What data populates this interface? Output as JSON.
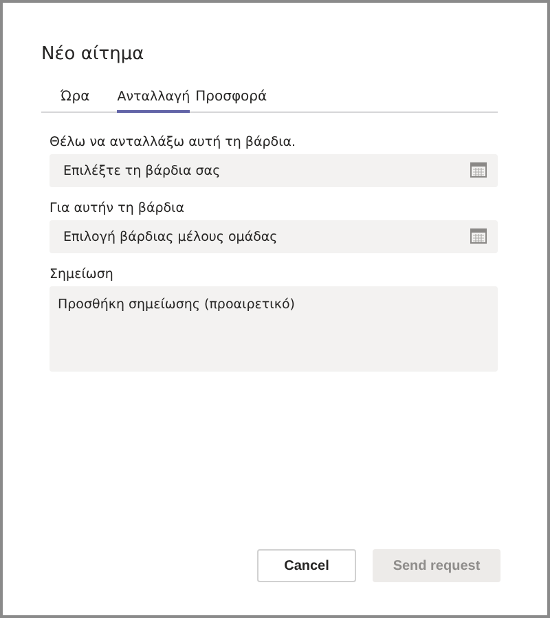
{
  "dialog": {
    "title": "Νέο αίτημα"
  },
  "tabs": [
    {
      "label": "Ώρα",
      "selected": false
    },
    {
      "label": "Ανταλλαγή",
      "selected": true
    },
    {
      "label": "Προσφορά",
      "selected": false
    }
  ],
  "fields": [
    {
      "kind": "date",
      "label": "Θέλω να ανταλλάξω αυτή τη βάρδια.",
      "placeholder": "Επιλέξτε τη βάρδια σας"
    },
    {
      "kind": "date",
      "label": "Για αυτήν τη βάρδια",
      "placeholder": "Επιλογή βάρδιας μέλους ομάδας"
    },
    {
      "kind": "note",
      "label": "Σημείωση",
      "placeholder": "Προσθήκη σημείωσης (προαιρετικό)"
    }
  ],
  "buttons": [
    {
      "label": "Cancel",
      "disabled": false
    },
    {
      "label": "Send request",
      "disabled": true
    }
  ]
}
